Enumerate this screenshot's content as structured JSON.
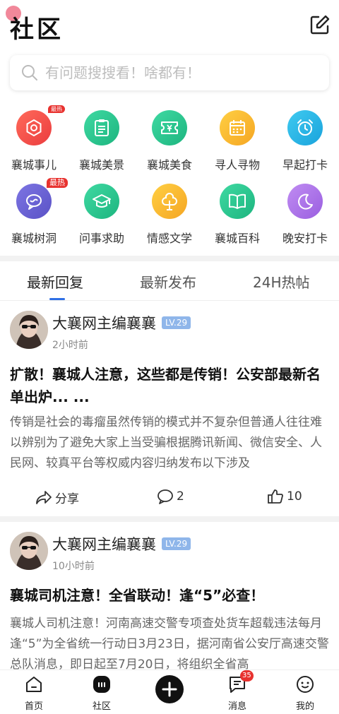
{
  "header": {
    "title": "社区"
  },
  "search": {
    "placeholder": "有问题搜搜看！啥都有！"
  },
  "categories": [
    {
      "label": "襄城事儿",
      "badge": "最热",
      "color": "#f0514d",
      "icon": "camera-icon"
    },
    {
      "label": "襄城美景",
      "color": "#27c48f",
      "icon": "clipboard-icon"
    },
    {
      "label": "襄城美食",
      "color": "#27c48f",
      "icon": "ticket-icon"
    },
    {
      "label": "寻人寻物",
      "color": "#f8b52a",
      "icon": "calendar-icon"
    },
    {
      "label": "早起打卡",
      "color": "#1fb3e3",
      "icon": "alarm-clock-icon"
    },
    {
      "label": "襄城树洞",
      "badge": "最热",
      "color": "#6a62d4",
      "icon": "chat-bubble-icon"
    },
    {
      "label": "问事求助",
      "color": "#27c48f",
      "icon": "graduation-cap-icon"
    },
    {
      "label": "情感文学",
      "color": "#f8b52a",
      "icon": "tree-icon"
    },
    {
      "label": "襄城百科",
      "color": "#27c48f",
      "icon": "book-icon"
    },
    {
      "label": "晚安打卡",
      "color": "#a66ee6",
      "icon": "moon-icon"
    }
  ],
  "tabs": [
    "最新回复",
    "最新发布",
    "24H热帖"
  ],
  "posts": [
    {
      "author": "大襄网主编襄襄",
      "level": "LV.29",
      "time": "2小时前",
      "title": "扩散！襄城人注意，这些都是传销！公安部最新名单出炉... ...",
      "body": "传销是社会的毒瘤虽然传销的模式并不复杂但普通人往往难以辨别为了避免大家上当受骗根据腾讯新闻、微信安全、人民网、较真平台等权威内容归纳发布以下涉及",
      "share": "分享",
      "comments": "2",
      "likes": "10"
    },
    {
      "author": "大襄网主编襄襄",
      "level": "LV.29",
      "time": "10小时前",
      "title": "襄城司机注意！全省联动！逢“5”必查！",
      "body": "襄城人司机注意！河南高速交警专项查处货车超载违法每月逢“5”为全省统一行动日3月23日，据河南省公安厅高速交警总队消息，即日起至7月20日，将组织全省高"
    }
  ],
  "bottom_nav": {
    "home": "首页",
    "community": "社区",
    "messages": "消息",
    "messages_badge": "35",
    "mine": "我的"
  }
}
